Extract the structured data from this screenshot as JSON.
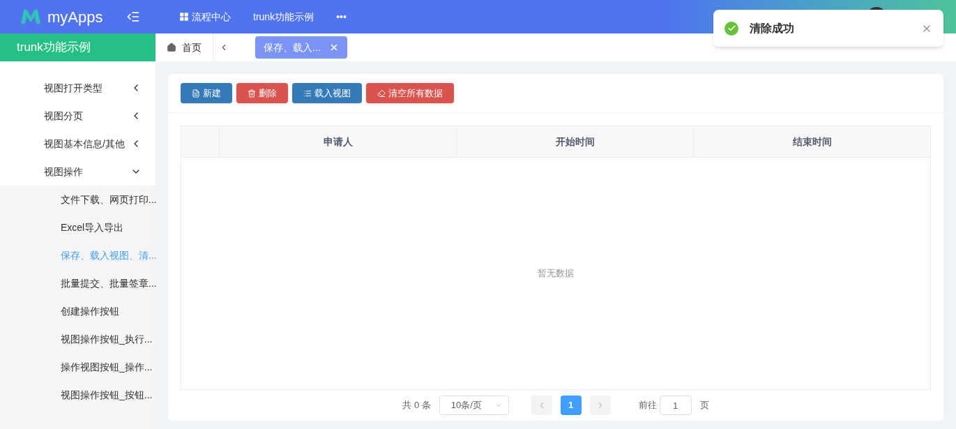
{
  "header": {
    "logo_text": "myApps",
    "nav": [
      {
        "label": "流程中心"
      },
      {
        "label": "trunk功能示例"
      },
      {
        "label": "•••"
      }
    ]
  },
  "sidebar": {
    "title": "trunk功能示例",
    "items": [
      {
        "label": "视图打开类型",
        "expanded": false,
        "selected": false
      },
      {
        "label": "视图分页",
        "expanded": false,
        "selected": false
      },
      {
        "label": "视图基本信息/其他",
        "expanded": false,
        "selected": false
      },
      {
        "label": "视图操作",
        "expanded": true,
        "selected": false,
        "children": [
          {
            "label": "文件下载、网页打印...",
            "selected": false
          },
          {
            "label": "Excel导入导出",
            "selected": false
          },
          {
            "label": "保存、载入视图、清...",
            "selected": true
          },
          {
            "label": "批量提交、批量签章...",
            "selected": false
          },
          {
            "label": "创建操作按钮",
            "selected": false
          },
          {
            "label": "视图操作按钮_执行...",
            "selected": false
          },
          {
            "label": "操作视图按钮_操作...",
            "selected": false
          },
          {
            "label": "视图操作按钮_按钮...",
            "selected": false
          }
        ]
      }
    ]
  },
  "tabs": {
    "home": "首页",
    "items": [
      {
        "label": "保存、载入...",
        "selected": true
      }
    ]
  },
  "toolbar": [
    {
      "label": "新建",
      "kind": "primary"
    },
    {
      "label": "删除",
      "kind": "danger"
    },
    {
      "label": "载入视图",
      "kind": "primary"
    },
    {
      "label": "清空所有数据",
      "kind": "danger"
    }
  ],
  "table": {
    "columns": [
      "申请人",
      "开始时间",
      "结束时间"
    ],
    "empty_text": "暂无数据"
  },
  "pagination": {
    "total": "共 0 条",
    "page_size": "10条/页",
    "pages": [
      {
        "label": "1",
        "selected": true
      }
    ],
    "goto_label": "前往",
    "goto_value": "1",
    "page_unit": "页"
  },
  "toast": {
    "kind": "success",
    "message": "清除成功"
  }
}
